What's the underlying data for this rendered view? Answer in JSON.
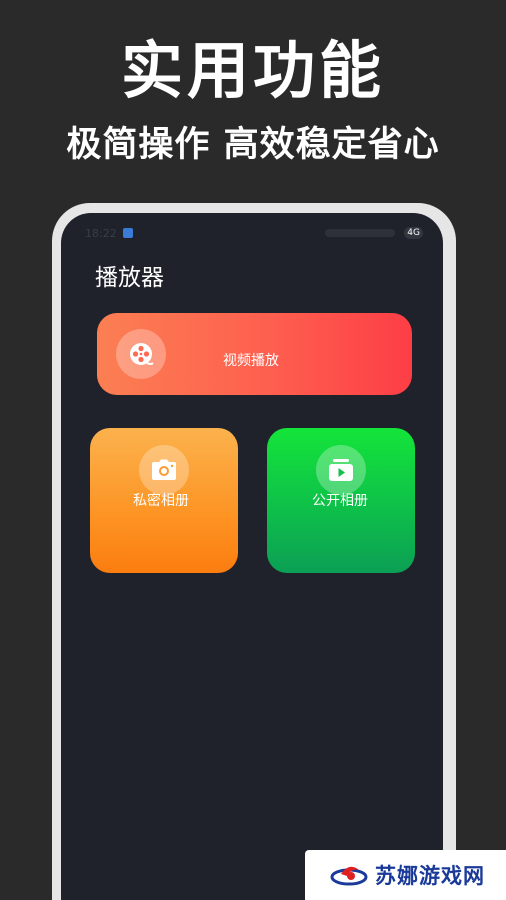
{
  "promo": {
    "headline": "实用功能",
    "subline": "极简操作 高效稳定省心"
  },
  "status_bar": {
    "time": "18:22",
    "network": "4G"
  },
  "screen": {
    "title": "播放器",
    "cards": {
      "video": {
        "label": "视频播放",
        "icon": "film-reel-icon"
      },
      "private_album": {
        "label": "私密相册",
        "icon": "camera-icon"
      },
      "public_album": {
        "label": "公开相册",
        "icon": "play-album-icon"
      }
    }
  },
  "watermark": {
    "text": "苏娜游戏网"
  },
  "colors": {
    "background": "#2a2a2a",
    "screen": "#1f222b",
    "video_card": "#fd5a4c",
    "private_card": "#fd9424",
    "public_card": "#0ec049",
    "watermark_text": "#1a3a9a"
  }
}
